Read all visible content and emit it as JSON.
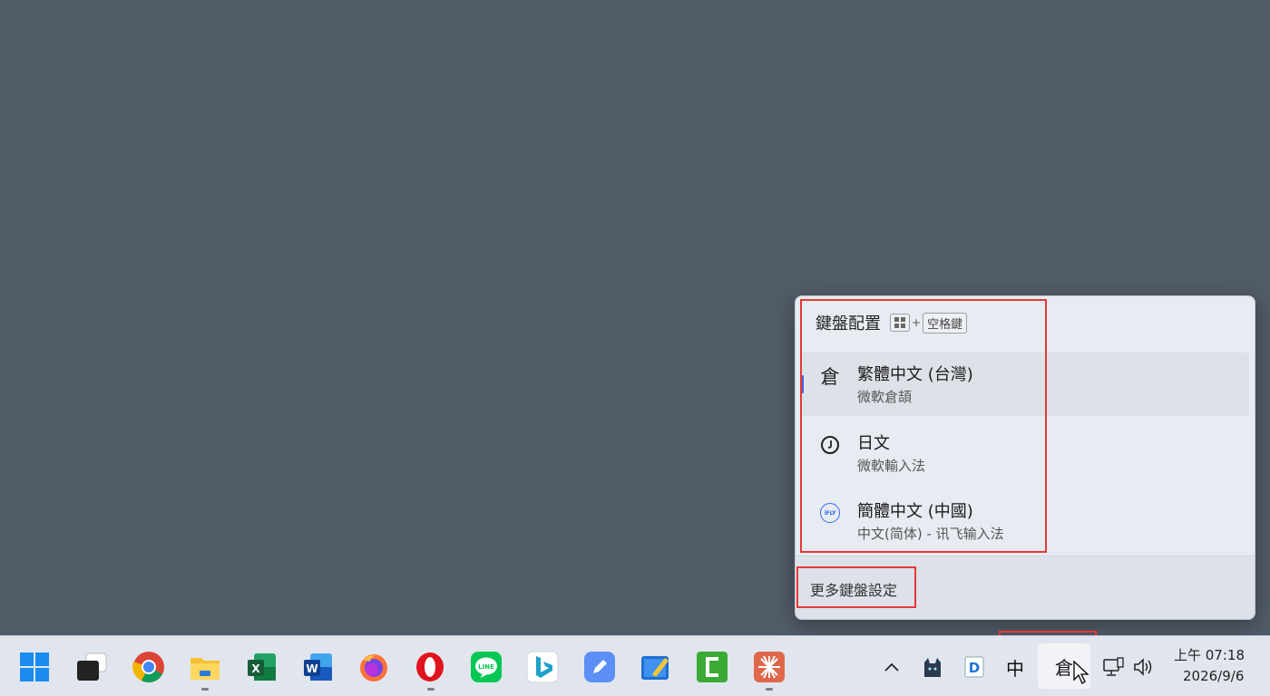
{
  "flyout": {
    "title": "鍵盤配置",
    "shortcut_plus": "+",
    "shortcut_key": "空格鍵",
    "items": [
      {
        "icon_text": "倉",
        "name": "繁體中文 (台灣)",
        "sub": "微軟倉頡",
        "icon": "cangjie-glyph-icon",
        "selected": true
      },
      {
        "name": "日文",
        "sub": "微軟輸入法",
        "icon": "japanese-ime-clock-icon"
      },
      {
        "icon_text": "iFLY",
        "name": "簡體中文 (中國)",
        "sub": "中文(简体) - 讯飞输入法",
        "icon": "ifly-logo-icon"
      }
    ],
    "more_settings": "更多鍵盤設定"
  },
  "taskbar": {
    "apps": [
      "start-icon",
      "task-view-icon",
      "chrome-icon",
      "file-explorer-icon",
      "excel-icon",
      "word-icon",
      "firefox-icon",
      "opera-icon",
      "line-icon",
      "bing-icon",
      "pen-notes-icon",
      "whiteboard-icon",
      "camtasia-icon",
      "sunburst-app-icon"
    ],
    "tray": {
      "chevron": "^",
      "ime_mode": "中",
      "ime_layout": "倉",
      "network_icon": "network-monitor-icon",
      "volume_icon": "speaker-icon"
    },
    "clock": {
      "time": "上午 07:18",
      "date": "2026/9/6"
    }
  },
  "colors": {
    "desktop": "#525c69",
    "taskbar": "#e1e6ee",
    "flyout": "#e7ebf2",
    "highlight": "#e53935",
    "selection_bar": "#4a5bd8"
  }
}
